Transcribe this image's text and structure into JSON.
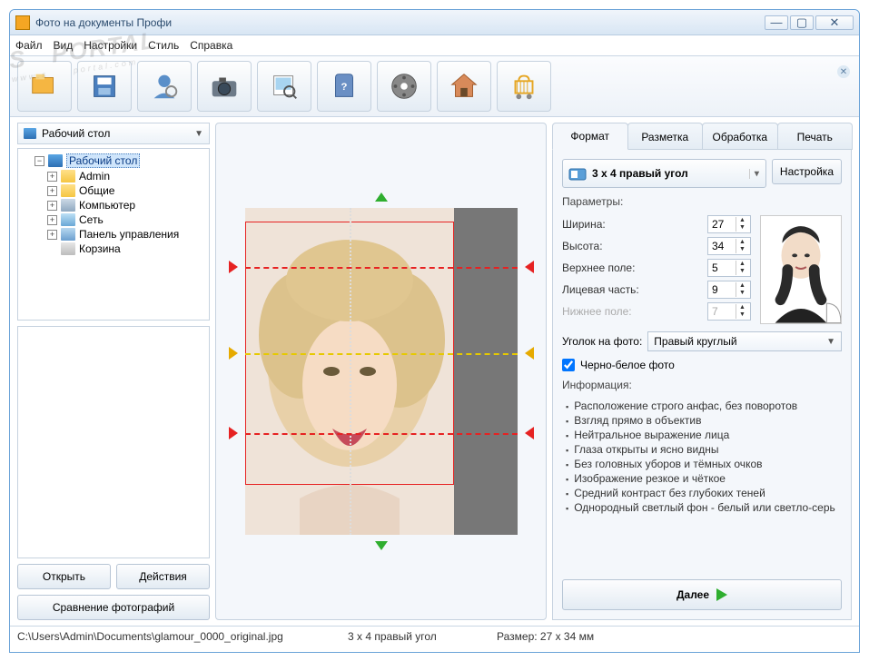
{
  "title": "Фото на документы Профи",
  "menu": {
    "file": "Файл",
    "view": "Вид",
    "settings": "Настройки",
    "style": "Стиль",
    "help": "Справка"
  },
  "location_label": "Рабочий стол",
  "tree": {
    "root": "Рабочий стол",
    "items": [
      "Admin",
      "Общие",
      "Компьютер",
      "Сеть",
      "Панель управления",
      "Корзина"
    ]
  },
  "left_buttons": {
    "open": "Открыть",
    "actions": "Действия",
    "compare": "Сравнение фотографий"
  },
  "tabs": {
    "format": "Формат",
    "markup": "Разметка",
    "process": "Обработка",
    "print": "Печать"
  },
  "format_name": "3 x 4 правый угол",
  "settings_btn": "Настройка",
  "params_label": "Параметры:",
  "params": {
    "width_label": "Ширина:",
    "width": "27",
    "height_label": "Высота:",
    "height": "34",
    "top_label": "Верхнее поле:",
    "top": "5",
    "face_label": "Лицевая часть:",
    "face": "9",
    "bottom_label": "Нижнее поле:",
    "bottom": "7"
  },
  "corner_label": "Уголок на фото:",
  "corner_value": "Правый круглый",
  "bw_label": "Черно-белое фото",
  "info_label": "Информация:",
  "info": [
    "Расположение строго анфас, без поворотов",
    "Взгляд прямо в объектив",
    "Нейтральное выражение лица",
    "Глаза открыты и ясно видны",
    "Без головных уборов и тёмных очков",
    "Изображение резкое и чёткое",
    "Средний контраст без глубоких теней",
    "Однородный светлый фон - белый или светло-серь"
  ],
  "next": "Далее",
  "status": {
    "path": "C:\\Users\\Admin\\Documents\\glamour_0000_original.jpg",
    "format": "3 x 4 правый угол",
    "size": "Размер: 27 x 34 мм"
  }
}
